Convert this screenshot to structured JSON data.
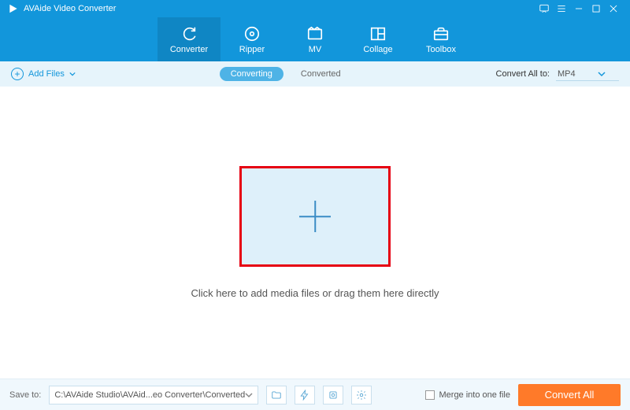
{
  "title": "AVAide Video Converter",
  "nav": [
    {
      "label": "Converter"
    },
    {
      "label": "Ripper"
    },
    {
      "label": "MV"
    },
    {
      "label": "Collage"
    },
    {
      "label": "Toolbox"
    }
  ],
  "subbar": {
    "add_files": "Add Files",
    "tabs": {
      "converting": "Converting",
      "converted": "Converted"
    },
    "convert_all_label": "Convert All to:",
    "format": "MP4"
  },
  "main": {
    "hint": "Click here to add media files or drag them here directly"
  },
  "footer": {
    "save_to_label": "Save to:",
    "path": "C:\\AVAide Studio\\AVAid...eo Converter\\Converted",
    "merge_label": "Merge into one file",
    "convert_button": "Convert All"
  }
}
